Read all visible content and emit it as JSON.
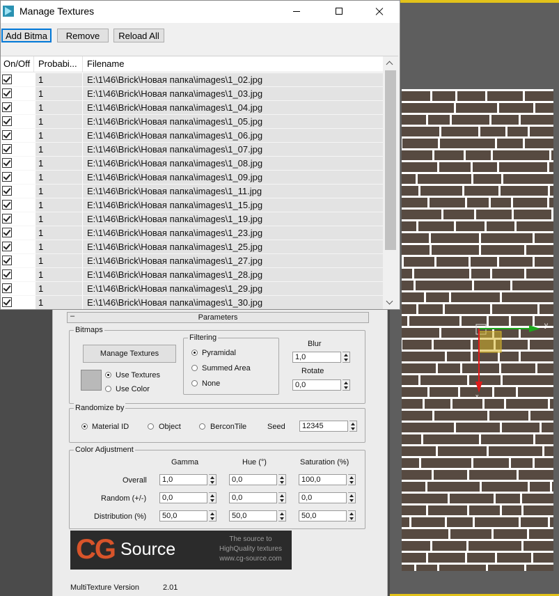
{
  "manage_textures": {
    "title": "Manage Textures",
    "buttons": {
      "add": "Add Bitma",
      "remove": "Remove",
      "reload": "Reload All"
    },
    "columns": [
      "On/Off",
      "Probabi...",
      "Filename"
    ],
    "rows": [
      {
        "on": true,
        "prob": "1",
        "file": "E:\\1\\46\\Brick\\Новая папка\\images\\1_02.jpg"
      },
      {
        "on": true,
        "prob": "1",
        "file": "E:\\1\\46\\Brick\\Новая папка\\images\\1_03.jpg"
      },
      {
        "on": true,
        "prob": "1",
        "file": "E:\\1\\46\\Brick\\Новая папка\\images\\1_04.jpg"
      },
      {
        "on": true,
        "prob": "1",
        "file": "E:\\1\\46\\Brick\\Новая папка\\images\\1_05.jpg"
      },
      {
        "on": true,
        "prob": "1",
        "file": "E:\\1\\46\\Brick\\Новая папка\\images\\1_06.jpg"
      },
      {
        "on": true,
        "prob": "1",
        "file": "E:\\1\\46\\Brick\\Новая папка\\images\\1_07.jpg"
      },
      {
        "on": true,
        "prob": "1",
        "file": "E:\\1\\46\\Brick\\Новая папка\\images\\1_08.jpg"
      },
      {
        "on": true,
        "prob": "1",
        "file": "E:\\1\\46\\Brick\\Новая папка\\images\\1_09.jpg"
      },
      {
        "on": true,
        "prob": "1",
        "file": "E:\\1\\46\\Brick\\Новая папка\\images\\1_11.jpg"
      },
      {
        "on": true,
        "prob": "1",
        "file": "E:\\1\\46\\Brick\\Новая папка\\images\\1_15.jpg"
      },
      {
        "on": true,
        "prob": "1",
        "file": "E:\\1\\46\\Brick\\Новая папка\\images\\1_19.jpg"
      },
      {
        "on": true,
        "prob": "1",
        "file": "E:\\1\\46\\Brick\\Новая папка\\images\\1_23.jpg"
      },
      {
        "on": true,
        "prob": "1",
        "file": "E:\\1\\46\\Brick\\Новая папка\\images\\1_25.jpg"
      },
      {
        "on": true,
        "prob": "1",
        "file": "E:\\1\\46\\Brick\\Новая папка\\images\\1_27.jpg"
      },
      {
        "on": true,
        "prob": "1",
        "file": "E:\\1\\46\\Brick\\Новая папка\\images\\1_28.jpg"
      },
      {
        "on": true,
        "prob": "1",
        "file": "E:\\1\\46\\Brick\\Новая папка\\images\\1_29.jpg"
      },
      {
        "on": true,
        "prob": "1",
        "file": "E:\\1\\46\\Brick\\Новая папка\\images\\1_30.jpg"
      }
    ]
  },
  "parameters": {
    "rollout_title": "Parameters",
    "rollout_toggle": "–",
    "bitmaps": {
      "label": "Bitmaps",
      "manage_button": "Manage Textures",
      "use_textures": "Use Textures",
      "use_color": "Use Color",
      "selected": "use_textures"
    },
    "filtering": {
      "label": "Filtering",
      "options": [
        "Pyramidal",
        "Summed Area",
        "None"
      ],
      "selected": "Pyramidal"
    },
    "blur": {
      "label": "Blur",
      "value": "1,0"
    },
    "rotate": {
      "label": "Rotate",
      "value": "0,0"
    },
    "randomize": {
      "label": "Randomize by",
      "options": [
        "Material ID",
        "Object",
        "BerconTile"
      ],
      "selected": "Material ID",
      "seed_label": "Seed",
      "seed_value": "12345"
    },
    "color_adjustment": {
      "label": "Color Adjustment",
      "columns": [
        "Gamma",
        "Hue (°)",
        "Saturation (%)"
      ],
      "rows": [
        {
          "label": "Overall",
          "values": [
            "1,0",
            "0,0",
            "100,0"
          ]
        },
        {
          "label": "Random (+/-)",
          "values": [
            "0,0",
            "0,0",
            "0,0"
          ]
        },
        {
          "label": "Distribution (%)",
          "values": [
            "50,0",
            "50,0",
            "50,0"
          ]
        }
      ]
    },
    "banner": {
      "logo_cg": "CG",
      "logo_source": "Source",
      "tagline": "The source to\nHighQuality textures\nwww.cg-source.com"
    },
    "version_label": "MultiTexture Version",
    "version_value": "2.01"
  },
  "viewport": {
    "brick_color": "#574a41",
    "mortar_color": "#ffffff",
    "axis_x_color": "#e01a1a",
    "axis_y_color": "#1ca81c",
    "gizmo_color": "#d6b52a",
    "axis_labels": [
      "y",
      "x"
    ]
  }
}
